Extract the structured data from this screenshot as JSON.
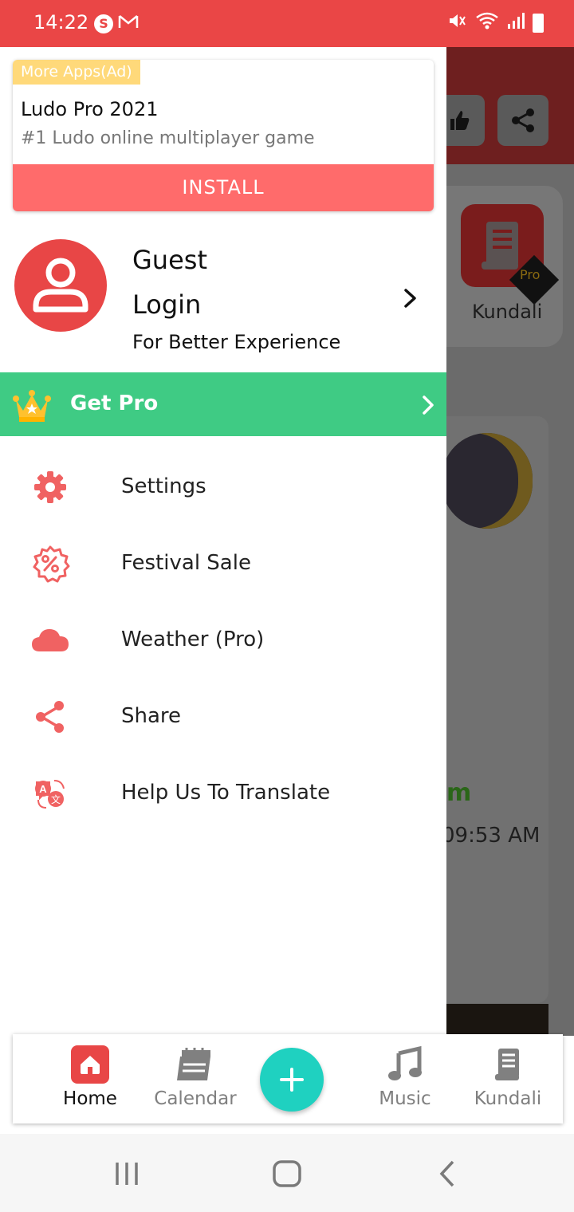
{
  "status_bar": {
    "time": "14:22",
    "s_icon": "S",
    "icons": [
      "skype-icon",
      "gmail-icon",
      "mute-icon",
      "wifi-icon",
      "signal-icon",
      "battery-icon"
    ]
  },
  "background": {
    "kundali_label": "Kundali",
    "pro_badge": "Pro",
    "partial_text": "m",
    "partial_time": "09:53 AM"
  },
  "ad": {
    "tag": "More Apps(Ad)",
    "title": "Ludo Pro 2021",
    "subtitle": "#1 Ludo online multiplayer game",
    "install_label": "INSTALL"
  },
  "profile": {
    "name": "Guest",
    "login_label": "Login",
    "tagline": "For Better Experience"
  },
  "get_pro": {
    "label": "Get Pro"
  },
  "menu": [
    {
      "label": "Settings",
      "icon": "gear-icon"
    },
    {
      "label": "Festival Sale",
      "icon": "discount-icon"
    },
    {
      "label": "Weather (Pro)",
      "icon": "cloud-icon"
    },
    {
      "label": "Share",
      "icon": "share-icon"
    },
    {
      "label": "Help Us To Translate",
      "icon": "translate-icon"
    }
  ],
  "bottom_nav": {
    "items": [
      {
        "label": "Home",
        "active": true
      },
      {
        "label": "Calendar",
        "active": false
      },
      {
        "label": "Music",
        "active": false
      },
      {
        "label": "Kundali",
        "active": false
      }
    ]
  },
  "colors": {
    "accent_red": "#ea4646",
    "menu_icon": "#f06262",
    "get_pro_green": "#3fcb84",
    "fab_teal": "#1fd1c0",
    "install_red": "#ff6b6b",
    "ad_tag_yellow": "#ffd97a"
  }
}
